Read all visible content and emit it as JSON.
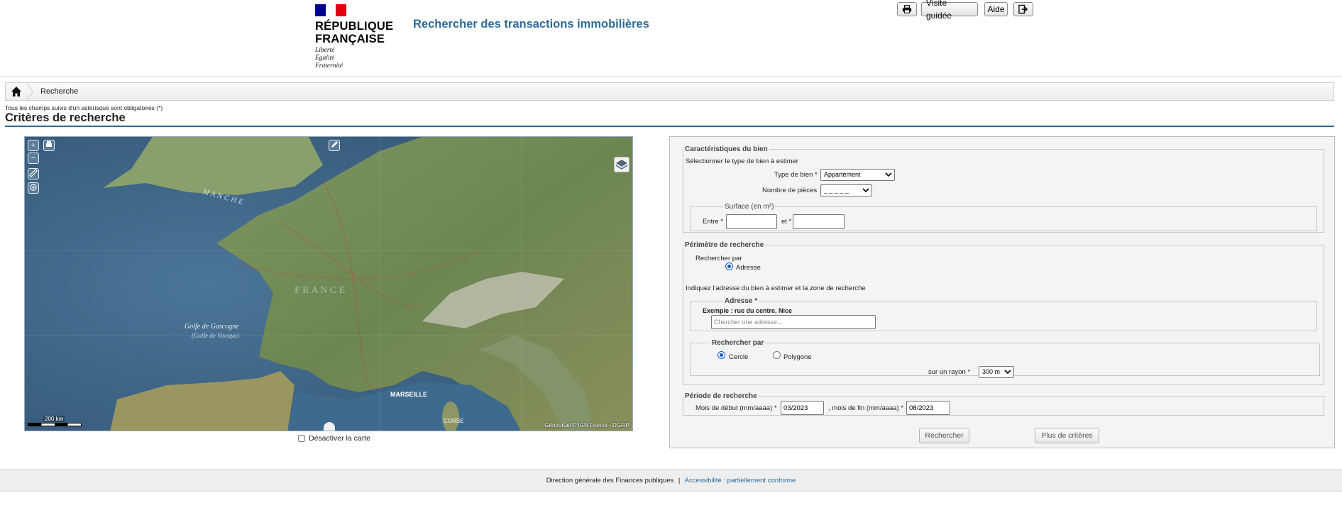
{
  "header": {
    "republic_line1": "RÉPUBLIQUE",
    "republic_line2": "FRANÇAISE",
    "motto_1": "Liberté",
    "motto_2": "Égalité",
    "motto_3": "Fraternité",
    "app_title": "Rechercher des transactions immobilières",
    "toolbar": {
      "print_icon": "printer-icon",
      "guided_tour_label": "Visite guidée",
      "help_label": "Aide",
      "logout_icon": "logout-icon"
    }
  },
  "breadcrumb": {
    "home_icon": "home-icon",
    "current": "Recherche"
  },
  "required_note": "Tous les champs suivis d'un astérisque sont obligatoires (*)",
  "section_title": "Critères de recherche",
  "map": {
    "zoom_in": "+",
    "zoom_out": "−",
    "scale_label": "200 km",
    "attribution": "Géoportail © IGN France - DGFiP",
    "labels": {
      "manche": "M A N C H E",
      "france": "F R A N C E",
      "gascogne": "Golfe de Gascogne",
      "biscaye": "(Golfe de Viscaya)",
      "marseille": "MARSEILLE",
      "corse": "CORSE"
    },
    "disable_label": "Désactiver la carte",
    "disable_checked": false
  },
  "form": {
    "characteristics": {
      "legend": "Caractéristiques du bien",
      "hint": "Sélectionner le type de bien à estimer",
      "type_label": "Type de bien *",
      "type_value": "Appartement",
      "rooms_label": "Nombre de pièces",
      "rooms_value": "_ _ _ _ _",
      "surface_legend": "Surface (en m²)",
      "between_label": "Entre *",
      "and_label": "et *",
      "surface_min": "",
      "surface_max": ""
    },
    "perimeter": {
      "legend": "Périmètre de recherche",
      "search_by_label": "Rechercher par",
      "address_radio": "Adresse",
      "hint": "Indiquez l'adresse du bien à estimer et la zone de recherche",
      "address_legend": "Adresse *",
      "example": "Exemple : rue du centre, Nice",
      "address_placeholder": "Chercher une adresse...",
      "shape_legend": "Rechercher par",
      "circle_label": "Cercle",
      "polygon_label": "Polygone",
      "radius_label": "sur un rayon *",
      "radius_value": "300 m"
    },
    "period": {
      "legend": "Période de recherche",
      "start_label": "Mois de début (mm/aaaa) *",
      "start_value": "03/2023",
      "end_label": ", mois de fin (mm/aaaa) *",
      "end_value": "08/2023"
    },
    "search_button": "Rechercher",
    "more_criteria_button": "Plus de critères"
  },
  "footer": {
    "org": "Direction générale des Finances publiques",
    "separator": "|",
    "accessibility": "Accessibilité : partiellement conforme"
  }
}
